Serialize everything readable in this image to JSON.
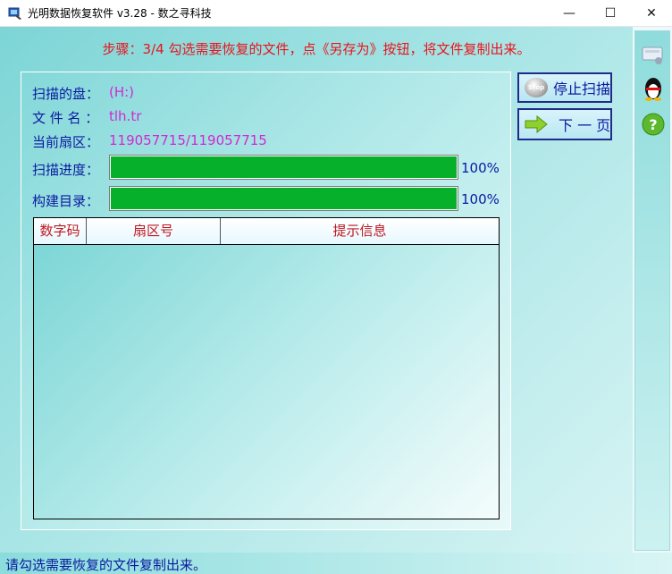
{
  "window": {
    "title": "光明数据恢复软件 v3.28 - 数之寻科技",
    "controls": {
      "minimize": "—",
      "maximize": "☐",
      "close": "✕"
    }
  },
  "header": {
    "step_text": "步骤：3/4 勾选需要恢复的文件，点《另存为》按钮，将文件复制出来。"
  },
  "scan_info": {
    "disk_label": "扫描的盘：",
    "disk_value": "(H:)",
    "file_label": "文 件 名 ：",
    "file_value": "tlh.tr",
    "sector_label": "当前扇区：",
    "sector_value": "119057715/119057715",
    "scan_progress_label": "扫描进度：",
    "scan_progress_pct": "100%",
    "scan_progress_value": 1.0,
    "build_label": "构建目录：",
    "build_pct": "100%",
    "build_value": 1.0
  },
  "table": {
    "columns": [
      "数字码",
      "扇区号",
      "提示信息"
    ],
    "rows": []
  },
  "buttons": {
    "stop_scan": "停止扫描",
    "stop_icon_text": "Stop",
    "next_page": "下 一 页"
  },
  "sidebar_icons": [
    "drive-icon",
    "qq-penguin-icon",
    "help-icon"
  ],
  "status": {
    "text": "请勾选需要恢复的文件复制出来。"
  },
  "colors": {
    "progress_fill": "#06b02a",
    "step_text": "#e8141c",
    "label_text": "#0a1aa0",
    "value_text": "#d228d2",
    "header_text": "#c0181e"
  }
}
